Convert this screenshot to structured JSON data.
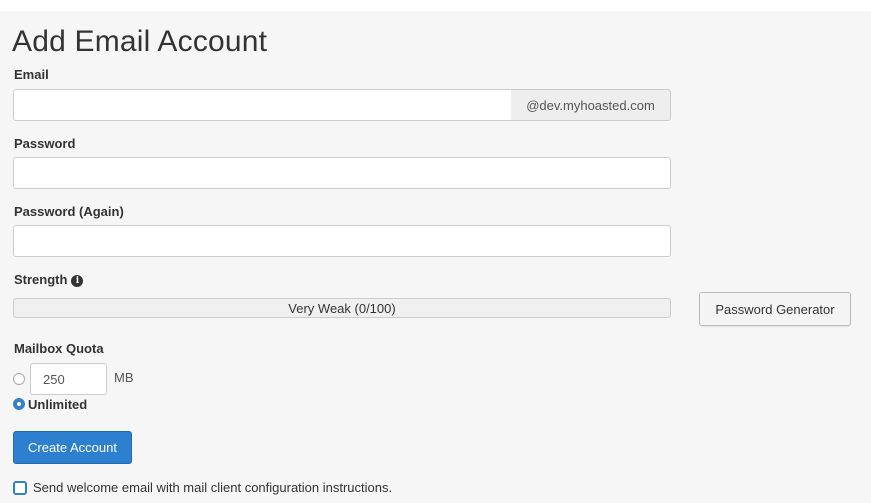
{
  "page": {
    "title": "Add Email Account"
  },
  "email": {
    "label": "Email",
    "value": "",
    "domain_suffix": "@dev.myhoasted.com"
  },
  "password": {
    "label": "Password",
    "value": ""
  },
  "password_again": {
    "label": "Password (Again)",
    "value": ""
  },
  "strength": {
    "label": "Strength",
    "info_icon": "info-circle-icon",
    "text": "Very Weak (0/100)",
    "score": 0,
    "max": 100,
    "generator_button": "Password Generator"
  },
  "quota": {
    "label": "Mailbox Quota",
    "limited_value": "250",
    "unit": "MB",
    "unlimited_label": "Unlimited",
    "selected": "unlimited"
  },
  "actions": {
    "create_button": "Create Account",
    "welcome_email_label": "Send welcome email with mail client configuration instructions.",
    "welcome_email_checked": false
  },
  "colors": {
    "primary": "#2d7fd0",
    "radio_selected": "#3183c8",
    "background": "#f6f6f6",
    "weak": "#d9534f"
  }
}
